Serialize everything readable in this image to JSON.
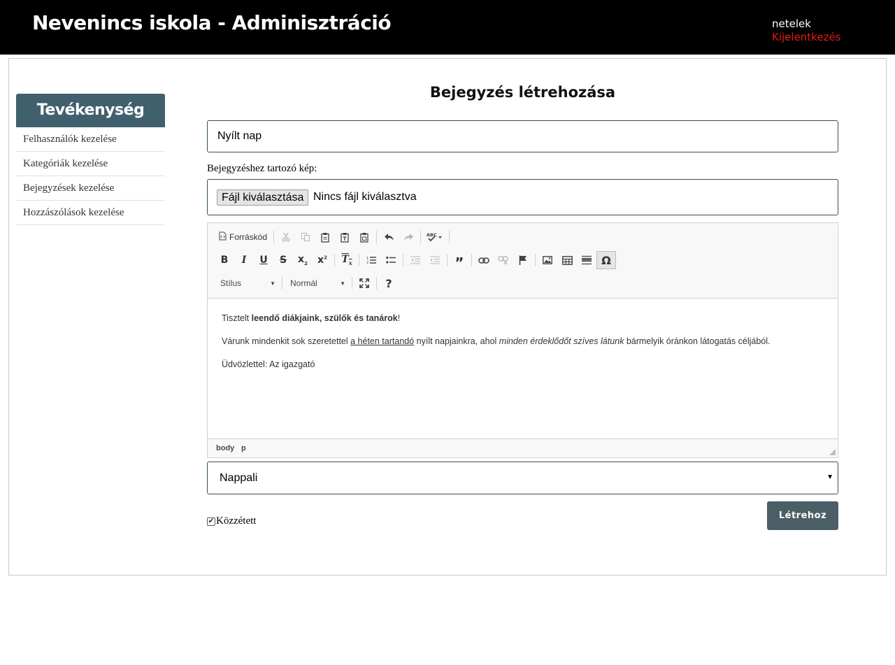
{
  "header": {
    "title": "Nevenincs iskola - Adminisztráció",
    "username": "netelek",
    "logout": "Kijelentkezés"
  },
  "sidebar": {
    "heading": "Tevékenység",
    "items": [
      {
        "label": "Felhasználók kezelése"
      },
      {
        "label": "Kategóriák kezelése"
      },
      {
        "label": "Bejegyzések kezelése"
      },
      {
        "label": "Hozzászólások kezelése"
      }
    ]
  },
  "form": {
    "heading": "Bejegyzés létrehozása",
    "title_value": "Nyílt nap",
    "image_label": "Bejegyzéshez tartozó kép:",
    "file_button": "Fájl kiválasztása",
    "file_status": "Nincs fájl kiválasztva",
    "category_value": "Nappali",
    "published_label": "Közzétett",
    "published_checked": true,
    "submit_label": "Létrehoz"
  },
  "editor": {
    "toolbar": {
      "source_label": "Forráskód",
      "style_combo": "Stílus",
      "format_combo": "Normál",
      "icons_row1": [
        "source-icon",
        "cut-icon",
        "copy-icon",
        "paste-icon",
        "paste-text-icon",
        "paste-word-icon",
        "undo-icon",
        "redo-icon",
        "spellcheck-icon"
      ],
      "icons_row2": [
        "bold-icon",
        "italic-icon",
        "underline-icon",
        "strike-icon",
        "subscript-icon",
        "superscript-icon",
        "remove-format-icon",
        "numbered-list-icon",
        "bulleted-list-icon",
        "outdent-icon",
        "indent-icon",
        "blockquote-icon",
        "link-icon",
        "unlink-icon",
        "anchor-icon",
        "image-icon",
        "table-icon",
        "horizontal-line-icon",
        "special-char-icon"
      ],
      "icons_row3": [
        "maximize-icon",
        "help-icon"
      ]
    },
    "content": {
      "p1_a": "Tisztelt ",
      "p1_b": "leendő diákjaink, szülők és tanárok",
      "p1_c": "!",
      "p2_a": "Várunk mindenkit sok szeretettel ",
      "p2_b": "a héten tartandó",
      "p2_c": " nyílt napjainkra, ahol ",
      "p2_d": "minden érdeklődőt szíves látunk",
      "p2_e": " bármelyik óránkon látogatás céljából.",
      "p3": "Üdvözlettel: Az igazgató"
    },
    "status_path": [
      "body",
      "p"
    ]
  }
}
